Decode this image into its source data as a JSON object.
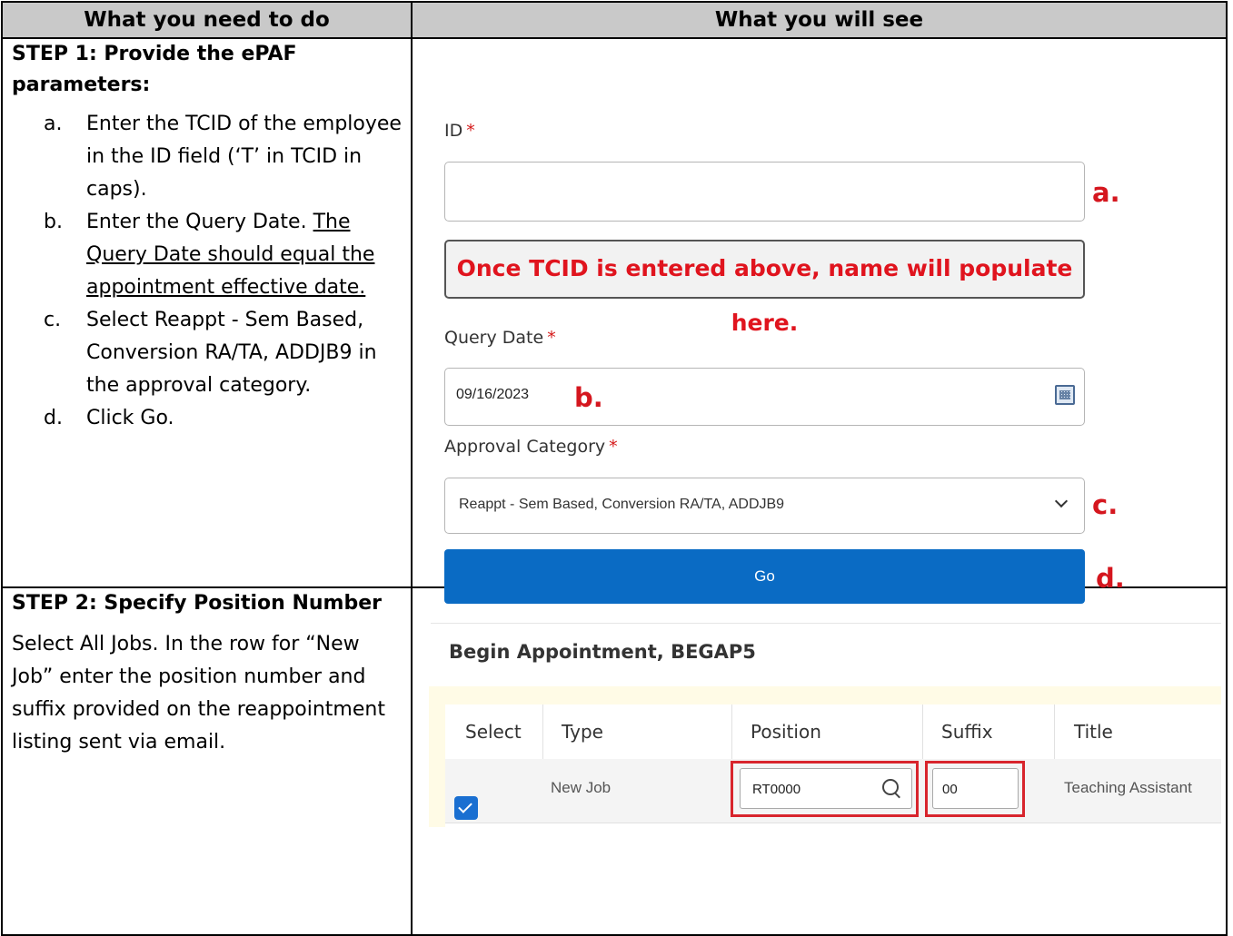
{
  "table": {
    "header_left": "What you need to do",
    "header_right": "What you will see"
  },
  "step1": {
    "title": "STEP 1: Provide the ePAF parameters:",
    "items": [
      {
        "letter": "a.",
        "text": "Enter the TCID of the employee in the ID field (‘T’ in TCID in caps)."
      },
      {
        "letter": "b.",
        "text_plain": "Enter the Query Date. ",
        "text_underlined": "The Query Date should equal the appointment effective date."
      },
      {
        "letter": "c.",
        "text": "Select Reappt - Sem Based, Conversion RA/TA, ADDJB9 in the approval category."
      },
      {
        "letter": "d.",
        "text": "Click Go."
      }
    ],
    "form": {
      "id_label": "ID",
      "required_mark": "*",
      "note": "Once TCID is entered above, name will populate here.",
      "query_date_label": "Query Date",
      "query_date_value": "09/16/2023",
      "approval_label": "Approval Category",
      "approval_value": "Reappt - Sem Based, Conversion RA/TA, ADDJB9",
      "go_label": "Go",
      "callouts": {
        "a": "a.",
        "b": "b.",
        "c": "c.",
        "d": "d."
      }
    }
  },
  "step2": {
    "title": "STEP 2: Specify Position Number",
    "text": "Select All Jobs. In the row for “New Job” enter the position number and suffix provided on the reappointment listing sent via email.",
    "screen": {
      "title": "Begin Appointment, BEGAP5",
      "columns": [
        "Select",
        "Type",
        "Position",
        "Suffix",
        "Title"
      ],
      "row": {
        "selected": true,
        "type": "New Job",
        "position": "RT0000",
        "suffix": "00",
        "title": "Teaching Assistant"
      }
    }
  },
  "colors": {
    "header_bg": "#c9c9c9",
    "callout_red": "#d5161e",
    "go_button_blue": "#0a6bc4",
    "checkbox_blue": "#1a6fd1"
  }
}
